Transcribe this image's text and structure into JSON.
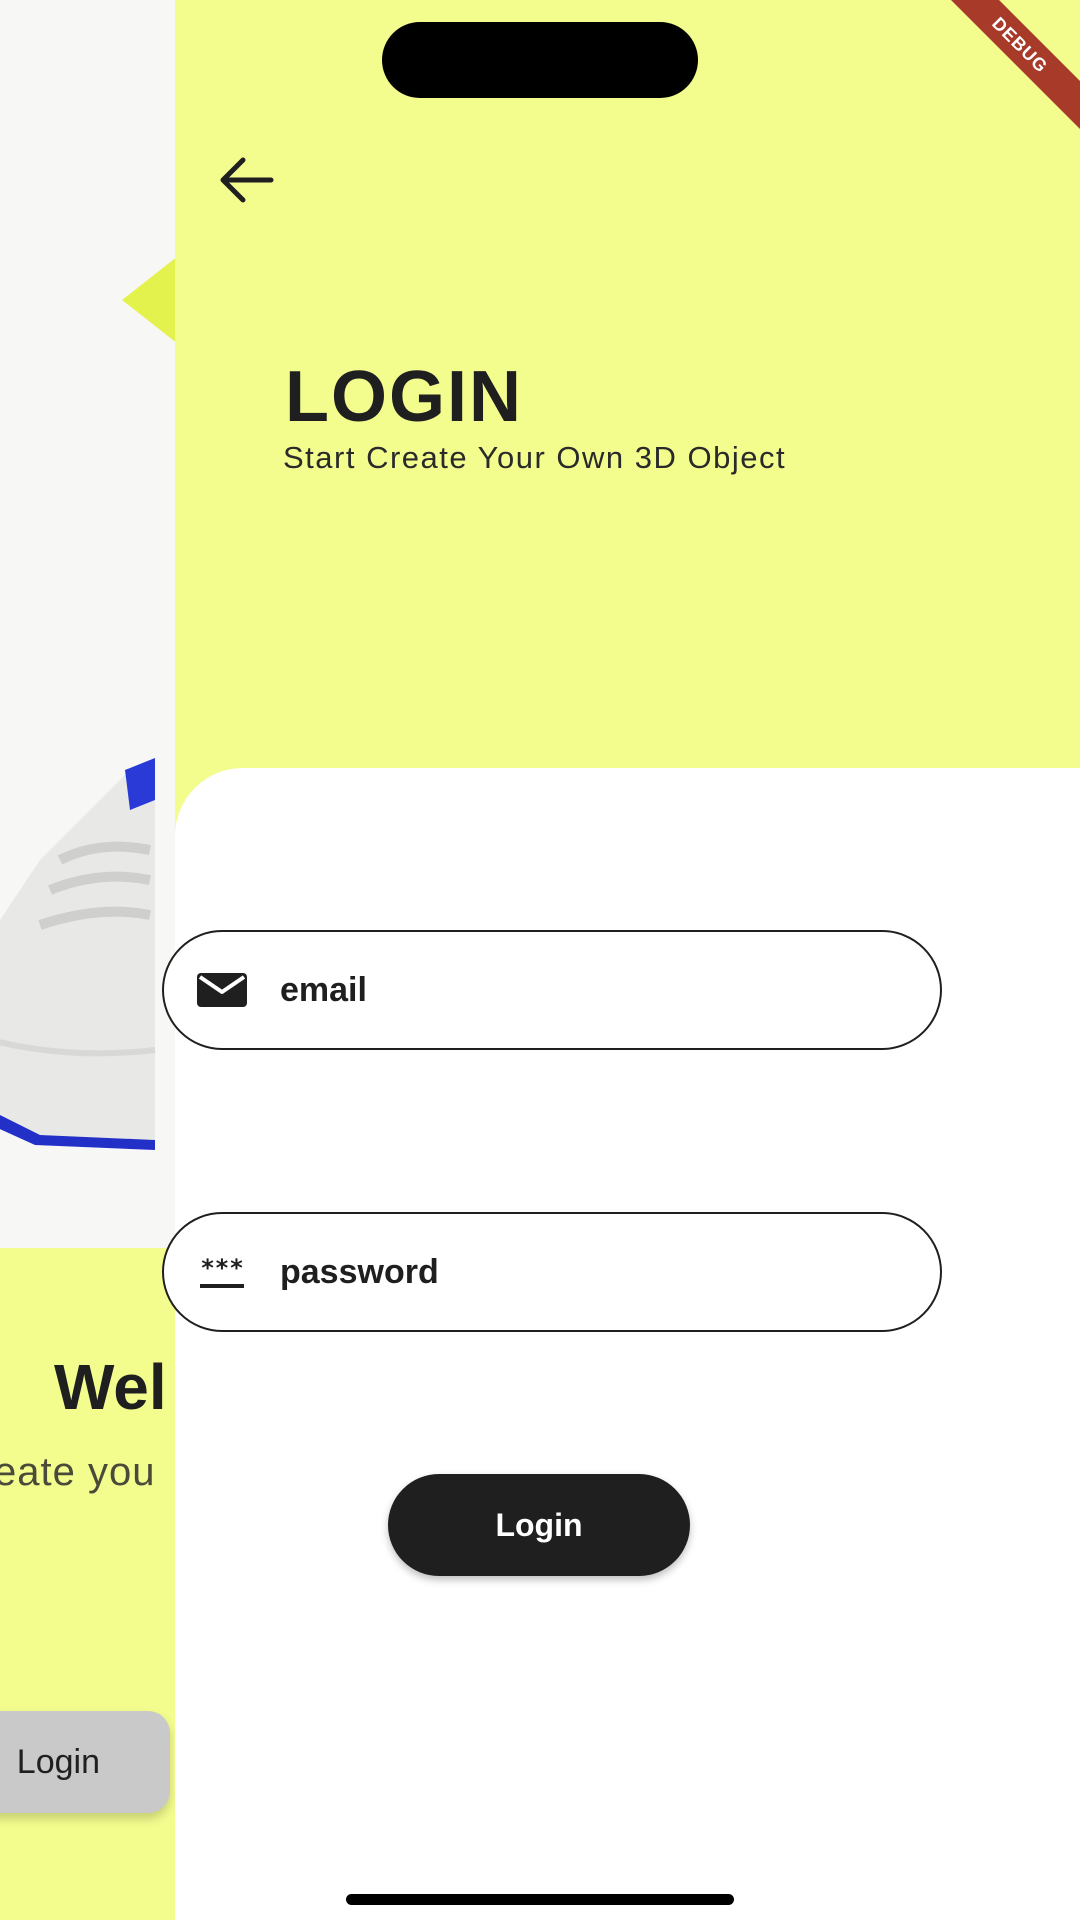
{
  "background_screen": {
    "welcome_text": "Wel",
    "subtitle_text": "eate you",
    "login_label": "Login"
  },
  "login_screen": {
    "debug_banner": "DEBUG",
    "title": "LOGIN",
    "subtitle": "Start Create Your Own 3D Object",
    "email_field": {
      "placeholder": "email",
      "icon": "mail-icon"
    },
    "password_field": {
      "placeholder": "password",
      "icon": "password-icon",
      "icon_glyph": "***"
    },
    "login_button": "Login",
    "back_icon": "arrow-back-icon"
  },
  "colors": {
    "accent_yellow": "#f3fd8e",
    "dark": "#1f1f1f",
    "white": "#ffffff",
    "debug_red": "#a83a2a"
  }
}
